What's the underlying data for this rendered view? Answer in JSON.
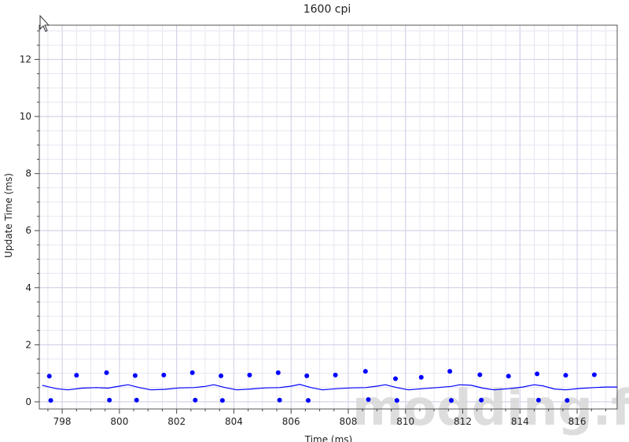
{
  "chart_data": {
    "type": "scatter",
    "title": "1600 cpi",
    "xlabel": "Time (ms)",
    "ylabel": "Update Time (ms)",
    "xlim": [
      797.2,
      817.4
    ],
    "ylim": [
      -0.25,
      13.2
    ],
    "x_ticks": [
      798,
      800,
      802,
      804,
      806,
      808,
      810,
      812,
      814,
      816
    ],
    "y_ticks": [
      0,
      2,
      4,
      6,
      8,
      10,
      12
    ],
    "grid": true,
    "legend": "none",
    "colors": {
      "points": "#0000ff",
      "line": "#0000ff",
      "grid_major": "#cfcfe8",
      "grid_minor": "#e6e6f2"
    },
    "series": [
      {
        "type": "scatter",
        "points": [
          [
            797.55,
            0.9
          ],
          [
            797.6,
            0.05
          ],
          [
            798.5,
            0.93
          ],
          [
            799.55,
            1.02
          ],
          [
            799.65,
            0.06
          ],
          [
            800.55,
            0.92
          ],
          [
            800.6,
            0.06
          ],
          [
            801.55,
            0.94
          ],
          [
            802.55,
            1.02
          ],
          [
            802.65,
            0.06
          ],
          [
            803.55,
            0.91
          ],
          [
            803.6,
            0.05
          ],
          [
            804.55,
            0.94
          ],
          [
            805.55,
            1.02
          ],
          [
            805.6,
            0.06
          ],
          [
            806.55,
            0.91
          ],
          [
            806.6,
            0.05
          ],
          [
            807.55,
            0.94
          ],
          [
            808.6,
            1.07
          ],
          [
            808.7,
            0.08
          ],
          [
            809.65,
            0.81
          ],
          [
            809.7,
            0.05
          ],
          [
            810.55,
            0.86
          ],
          [
            811.55,
            1.07
          ],
          [
            811.6,
            0.05
          ],
          [
            812.6,
            0.95
          ],
          [
            812.65,
            0.06
          ],
          [
            813.6,
            0.9
          ],
          [
            814.6,
            0.98
          ],
          [
            814.65,
            0.06
          ],
          [
            815.6,
            0.93
          ],
          [
            815.65,
            0.05
          ],
          [
            816.6,
            0.95
          ]
        ]
      },
      {
        "type": "line",
        "points": [
          [
            797.3,
            0.58
          ],
          [
            797.8,
            0.46
          ],
          [
            798.2,
            0.42
          ],
          [
            798.7,
            0.48
          ],
          [
            799.2,
            0.5
          ],
          [
            799.6,
            0.48
          ],
          [
            800.0,
            0.55
          ],
          [
            800.3,
            0.6
          ],
          [
            800.7,
            0.5
          ],
          [
            801.1,
            0.42
          ],
          [
            801.6,
            0.44
          ],
          [
            802.1,
            0.49
          ],
          [
            802.6,
            0.5
          ],
          [
            803.0,
            0.54
          ],
          [
            803.3,
            0.6
          ],
          [
            803.7,
            0.5
          ],
          [
            804.1,
            0.42
          ],
          [
            804.6,
            0.45
          ],
          [
            805.1,
            0.49
          ],
          [
            805.6,
            0.5
          ],
          [
            806.0,
            0.55
          ],
          [
            806.3,
            0.61
          ],
          [
            806.7,
            0.5
          ],
          [
            807.1,
            0.42
          ],
          [
            807.6,
            0.46
          ],
          [
            808.1,
            0.49
          ],
          [
            808.6,
            0.5
          ],
          [
            809.0,
            0.55
          ],
          [
            809.3,
            0.6
          ],
          [
            809.7,
            0.5
          ],
          [
            810.1,
            0.42
          ],
          [
            810.6,
            0.46
          ],
          [
            811.1,
            0.5
          ],
          [
            811.6,
            0.54
          ],
          [
            811.9,
            0.6
          ],
          [
            812.3,
            0.58
          ],
          [
            812.7,
            0.48
          ],
          [
            813.1,
            0.42
          ],
          [
            813.6,
            0.46
          ],
          [
            814.1,
            0.52
          ],
          [
            814.5,
            0.6
          ],
          [
            814.8,
            0.56
          ],
          [
            815.2,
            0.45
          ],
          [
            815.6,
            0.42
          ],
          [
            816.1,
            0.47
          ],
          [
            816.6,
            0.5
          ],
          [
            817.0,
            0.52
          ],
          [
            817.4,
            0.52
          ]
        ]
      }
    ]
  },
  "watermark": "modding.fr"
}
